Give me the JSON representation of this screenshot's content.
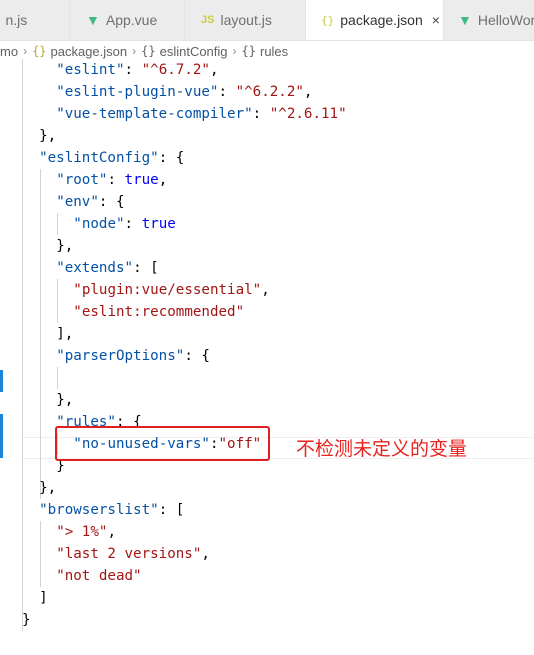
{
  "tabs": [
    {
      "icon": "JS",
      "label": "n.js",
      "active": false
    },
    {
      "icon": "V",
      "label": "App.vue",
      "active": false
    },
    {
      "icon": "JS",
      "label": "layout.js",
      "active": false
    },
    {
      "icon": "{}",
      "label": "package.json",
      "active": true,
      "close": "×"
    },
    {
      "icon": "V",
      "label": "HelloWorld",
      "active": false
    }
  ],
  "breadcrumb": {
    "root": "mo",
    "items": [
      "package.json",
      "eslintConfig",
      "rules"
    ],
    "icons": [
      "{}",
      "{}",
      "{}"
    ],
    "sep": "›"
  },
  "code": [
    {
      "k": "\"eslint\"",
      "v": "\"^6.7.2\"",
      "t": ","
    },
    {
      "k": "\"eslint-plugin-vue\"",
      "v": "\"^6.2.2\"",
      "t": ","
    },
    {
      "k": "\"vue-template-compiler\"",
      "v": "\"^2.6.11\"",
      "t": ""
    },
    {
      "p": "},"
    },
    {
      "k": "\"eslintConfig\"",
      "p2": ": {"
    },
    {
      "k": "\"root\"",
      "b": "true",
      "t": ","
    },
    {
      "k": "\"env\"",
      "p2": ": {"
    },
    {
      "k": "\"node\"",
      "b": "true"
    },
    {
      "p": "},"
    },
    {
      "k": "\"extends\"",
      "p2": ": ["
    },
    {
      "s": "\"plugin:vue/essential\"",
      "t": ","
    },
    {
      "s": "\"eslint:recommended\""
    },
    {
      "p": "],"
    },
    {
      "k": "\"parserOptions\"",
      "p2": ": {"
    },
    {
      "p": ""
    },
    {
      "p": "},"
    },
    {
      "k": "\"rules\"",
      "p2": ": {"
    },
    {
      "k": "\"no-unused-vars\"",
      "sep": ":",
      "s": "\"off\""
    },
    {
      "p": "}"
    },
    {
      "p": "},"
    },
    {
      "k": "\"browserslist\"",
      "p2": ": ["
    },
    {
      "s": "\"> 1%\"",
      "t": ","
    },
    {
      "s": "\"last 2 versions\"",
      "t": ","
    },
    {
      "s": "\"not dead\""
    },
    {
      "p": "]"
    },
    {
      "p": "}"
    }
  ],
  "annotation": "不检测未定义的变量",
  "colors": {
    "key": "#0451a5",
    "string": "#a31515",
    "boolean": "#0000ff",
    "annotation": "#e8231f"
  }
}
